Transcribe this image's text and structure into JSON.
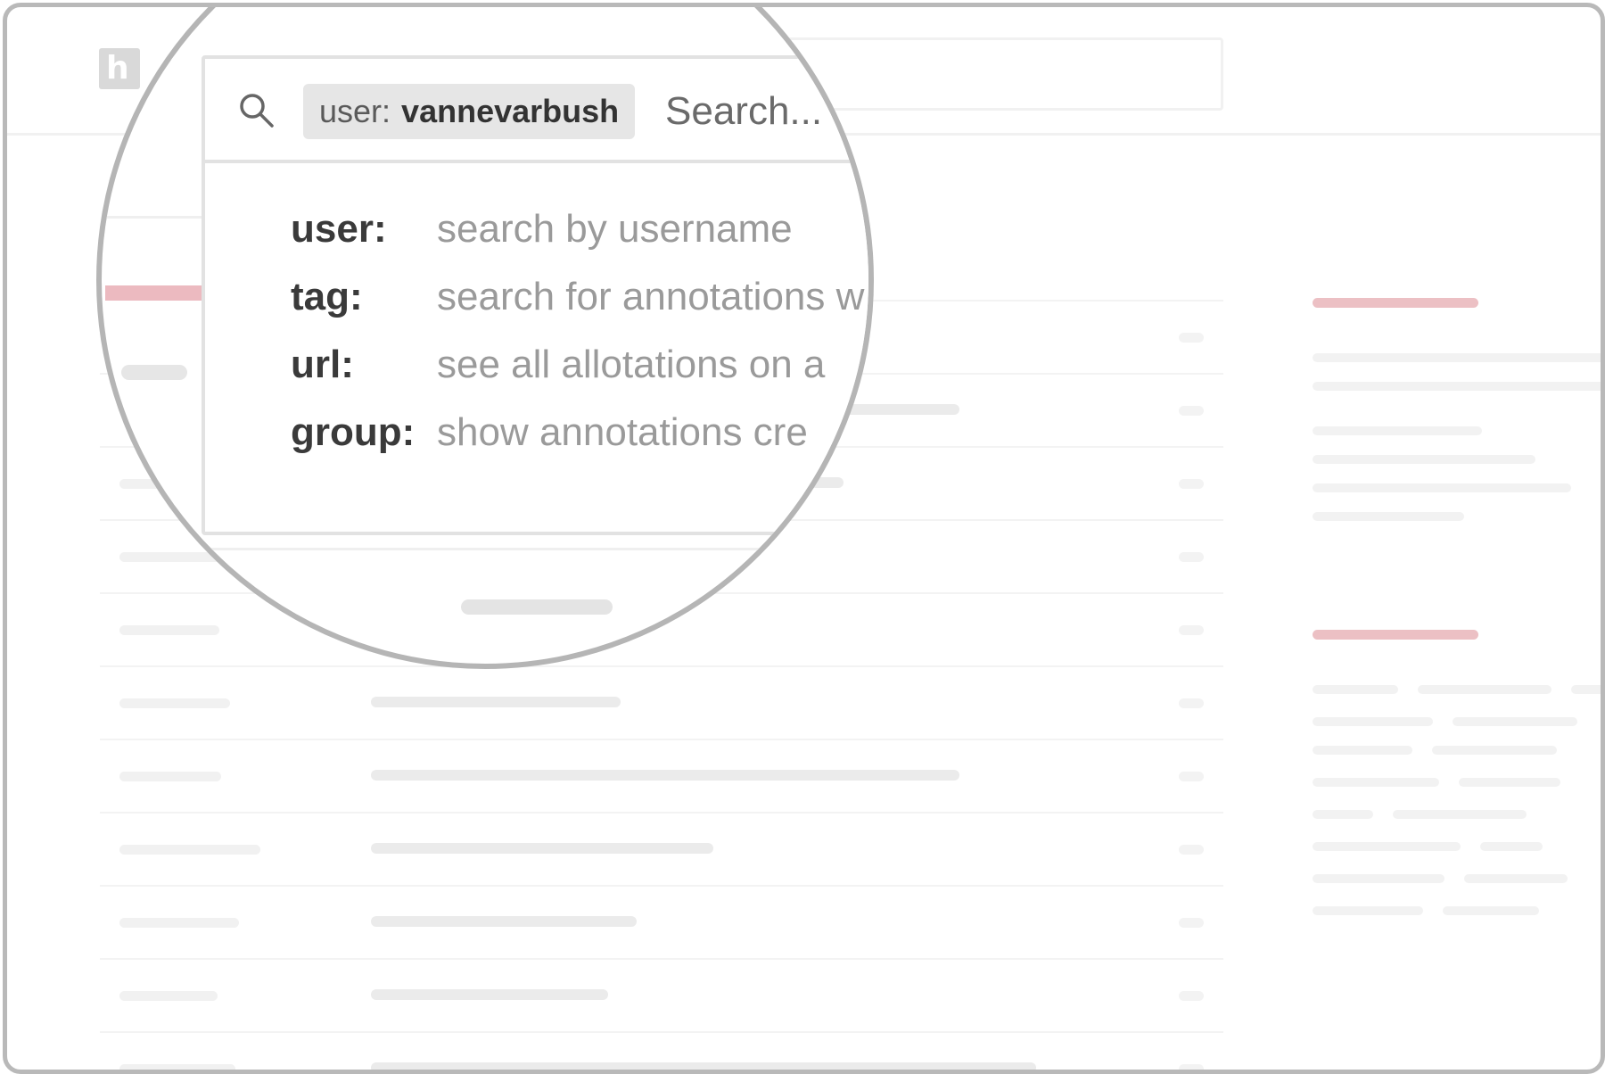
{
  "logo": {
    "letter": "h"
  },
  "search": {
    "chip_key": "user:",
    "chip_value": "vannevarbush",
    "placeholder": "Search..."
  },
  "suggestions": [
    {
      "key": "user:",
      "description": "search by username"
    },
    {
      "key": "tag:",
      "description": "search for annotations w"
    },
    {
      "key": "url:",
      "description": "see all allotations on a"
    },
    {
      "key": "group:",
      "description": "show annotations cre"
    }
  ],
  "colors": {
    "accent": "#ecc0c4",
    "frame": "#b9b9b9",
    "chip_bg": "#e6e6e6"
  },
  "icons": {
    "search": "search-icon"
  }
}
